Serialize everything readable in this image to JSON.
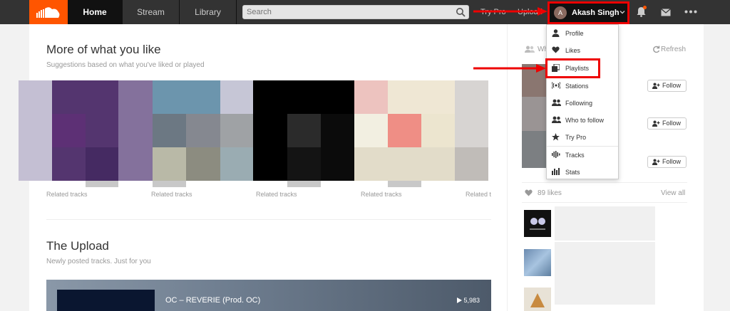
{
  "nav": {
    "home": "Home",
    "stream": "Stream",
    "library": "Library",
    "search_placeholder": "Search",
    "try_pro": "Try Pro",
    "upload": "Upload",
    "user_initial": "A",
    "user_name": "Akash Singh"
  },
  "main": {
    "section1_title": "More of what you like",
    "section1_sub": "Suggestions based on what you've liked or played",
    "related_label": "Related tracks",
    "related_label_cut": "Related t",
    "section2_title": "The Upload",
    "section2_sub": "Newly posted tracks. Just for you",
    "track_title": "OC – REVERIE (Prod. OC)",
    "track_plays": "5,983"
  },
  "sidebar": {
    "who_to_follow_cut": "Wh",
    "refresh": "Refresh",
    "follow_label": "Follow",
    "likes_count": "89 likes",
    "view_all": "View all"
  },
  "dropdown": {
    "items": [
      "Profile",
      "Likes",
      "Playlists",
      "Stations",
      "Following",
      "Who to follow",
      "Try Pro",
      "Tracks",
      "Stats"
    ]
  },
  "colors": {
    "brand": "#ff5500",
    "header_bg": "#333333",
    "highlight": "#ee0000"
  }
}
